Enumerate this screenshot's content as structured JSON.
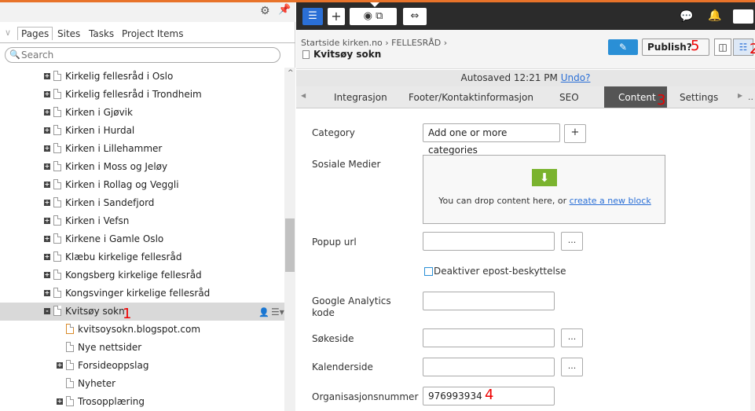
{
  "left_panel": {
    "tabs": [
      "Pages",
      "Sites",
      "Tasks",
      "Project Items"
    ],
    "search_placeholder": "Search",
    "tree": [
      {
        "label": "Kirkelig fellesråd i Oslo",
        "level": 1,
        "expander": "+",
        "selected": false
      },
      {
        "label": "Kirkelig fellesråd i Trondheim",
        "level": 1,
        "expander": "+",
        "selected": false
      },
      {
        "label": "Kirken i Gjøvik",
        "level": 1,
        "expander": "+",
        "selected": false
      },
      {
        "label": "Kirken i Hurdal",
        "level": 1,
        "expander": "+",
        "selected": false
      },
      {
        "label": "Kirken i Lillehammer",
        "level": 1,
        "expander": "+",
        "selected": false
      },
      {
        "label": "Kirken i Moss og Jeløy",
        "level": 1,
        "expander": "+",
        "selected": false
      },
      {
        "label": "Kirken i Rollag og Veggli",
        "level": 1,
        "expander": "+",
        "selected": false
      },
      {
        "label": "Kirken i Sandefjord",
        "level": 1,
        "expander": "+",
        "selected": false
      },
      {
        "label": "Kirken i Vefsn",
        "level": 1,
        "expander": "+",
        "selected": false
      },
      {
        "label": "Kirkene i Gamle Oslo",
        "level": 1,
        "expander": "+",
        "selected": false
      },
      {
        "label": "Klæbu kirkelige fellesråd",
        "level": 1,
        "expander": "+",
        "selected": false
      },
      {
        "label": "Kongsberg kirkelige fellesråd",
        "level": 1,
        "expander": "+",
        "selected": false
      },
      {
        "label": "Kongsvinger kirkelige fellesråd",
        "level": 1,
        "expander": "+",
        "selected": false
      },
      {
        "label": "Kvitsøy sokn",
        "level": 1,
        "expander": "-",
        "selected": true
      },
      {
        "label": "kvitsoysokn.blogspot.com",
        "level": 2,
        "expander": "",
        "selected": false,
        "link": true
      },
      {
        "label": "Nye nettsider",
        "level": 2,
        "expander": "",
        "selected": false
      },
      {
        "label": "Forsideoppslag",
        "level": 2,
        "expander": "+",
        "selected": false
      },
      {
        "label": "Nyheter",
        "level": 2,
        "expander": "",
        "selected": false
      },
      {
        "label": "Trosopplæring",
        "level": 2,
        "expander": "+",
        "selected": false
      }
    ]
  },
  "annotations": {
    "a1": "1",
    "a2": "2",
    "a3": "3",
    "a4": "4",
    "a5": "5"
  },
  "header": {
    "breadcrumb": "Startside kirken.no › FELLESRÅD ›",
    "page_title": "Kvitsøy sokn",
    "publish_label": "Publish?",
    "autosave_text": "Autosaved 12:21 PM",
    "undo_label": "Undo?"
  },
  "tabs": [
    "Integrasjon",
    "Footer/Kontaktinformasjon",
    "SEO",
    "Content",
    "Settings"
  ],
  "active_tab": "Content",
  "form": {
    "category_label": "Category",
    "category_button": "Add one or more categories",
    "category_add": "+",
    "social_label": "Sosiale Medier",
    "drop_text": "You can drop content here, or",
    "drop_link": "create a new block",
    "popup_label": "Popup url",
    "popup_value": "",
    "browse": "...",
    "checkbox_label": "Deaktiver epost-beskyttelse",
    "checkbox_checked": false,
    "ga_label": "Google Analytics kode",
    "ga_value": "",
    "search_page_label": "Søkeside",
    "search_page_value": "",
    "calendar_label": "Kalenderside",
    "calendar_value": "",
    "org_label": "Organisasjonsnummer",
    "org_value": "976993934"
  },
  "colors": {
    "accent": "#2a6fd6",
    "toolbar": "#2b2b2b",
    "active_tab": "#555555",
    "annotation": "#e00000",
    "drop_icon": "#7ab32e"
  }
}
